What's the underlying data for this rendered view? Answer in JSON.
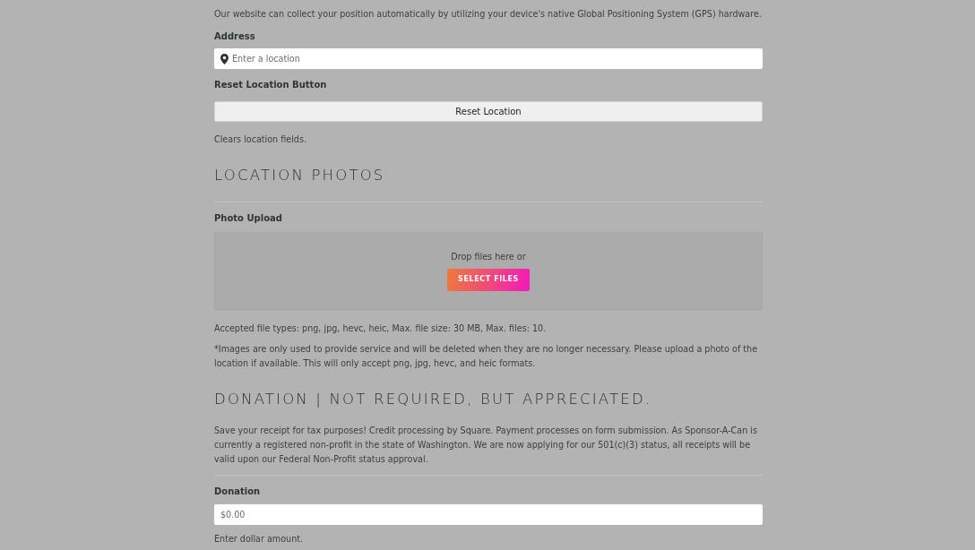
{
  "intro": "Our website can collect your position automatically by utilizing your device's native Global Positioning System (GPS) hardware.",
  "address": {
    "label": "Address",
    "placeholder": "Enter a location"
  },
  "reset": {
    "label": "Reset Location Button",
    "button": "Reset Location",
    "help": "Clears location fields."
  },
  "photos": {
    "heading": "LOCATION PHOTOS",
    "label": "Photo Upload",
    "drop_text": "Drop files here or",
    "button": "SELECT FILES",
    "accepted": "Accepted file types: png, jpg, hevc, heic, Max. file size: 30 MB, Max. files: 10.",
    "note": "*Images are only used to provide service and will be deleted when they are no longer necessary. Please upload a photo of the location if available. This will only accept png, jpg, hevc, and heic formats."
  },
  "donation": {
    "heading": "DONATION | NOT REQUIRED, BUT APPRECIATED.",
    "description": "Save your receipt for tax purposes! Credit processing by Square. Payment processes on form submission. As Sponsor-A-Can is currently a registered non-profit in the state of Washington. We are now applying for our 501(c)(3) status, all receipts will be valid upon our Federal Non-Profit status approval.",
    "label": "Donation",
    "placeholder": "$0.00",
    "help": "Enter dollar amount."
  }
}
